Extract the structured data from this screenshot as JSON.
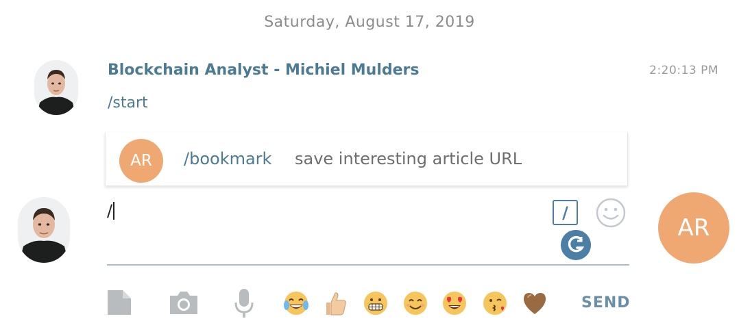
{
  "date_separator": "Saturday, August 17, 2019",
  "message": {
    "sender": "Blockchain Analyst - Michiel Mulders",
    "time": "2:20:13 PM",
    "text": "/start"
  },
  "suggestion": {
    "avatar_initials": "AR",
    "command": "/bookmark",
    "description": "save interesting article URL"
  },
  "composer": {
    "value": "/",
    "user_initials": "AR"
  },
  "toolbar": {
    "icons": [
      "file-icon",
      "camera-icon",
      "microphone-icon"
    ],
    "emojis": [
      "joy-emoji",
      "thumbs-up-emoji",
      "grimace-emoji",
      "smile-emoji",
      "heart-eyes-emoji",
      "kiss-emoji",
      "brown-heart-emoji"
    ],
    "send_label": "SEND"
  },
  "colors": {
    "accent": "#4b7a93",
    "avatar_orange": "#f0a873",
    "input_underline": "#a9bccb"
  }
}
